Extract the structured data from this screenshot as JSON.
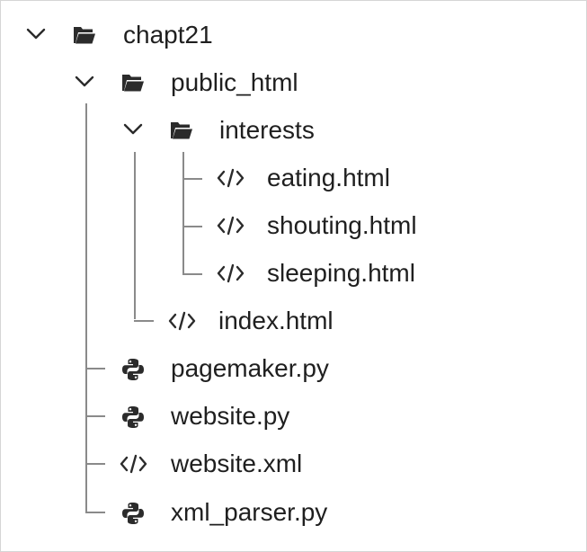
{
  "tree": {
    "root": {
      "label": "chapt21",
      "icon": "folder-open-icon",
      "expanded": true
    },
    "public_html": {
      "label": "public_html",
      "icon": "folder-open-icon",
      "expanded": true
    },
    "interests": {
      "label": "interests",
      "icon": "folder-open-icon",
      "expanded": true,
      "children": [
        {
          "label": "eating.html",
          "icon": "code-file-icon"
        },
        {
          "label": "shouting.html",
          "icon": "code-file-icon"
        },
        {
          "label": "sleeping.html",
          "icon": "code-file-icon"
        }
      ]
    },
    "index": {
      "label": "index.html",
      "icon": "code-file-icon"
    },
    "root_files": [
      {
        "label": "pagemaker.py",
        "icon": "python-file-icon"
      },
      {
        "label": "website.py",
        "icon": "python-file-icon"
      },
      {
        "label": "website.xml",
        "icon": "code-file-icon"
      },
      {
        "label": "xml_parser.py",
        "icon": "python-file-icon"
      }
    ]
  },
  "colors": {
    "text": "#1f1f1f",
    "icon": "#2b2b2b",
    "guide_line": "#8a8a8a",
    "border": "#d6d6d6",
    "background": "#ffffff"
  }
}
